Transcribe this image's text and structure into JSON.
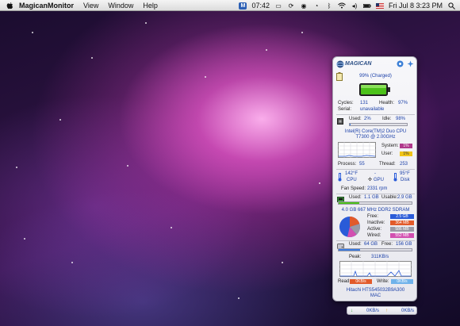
{
  "menubar": {
    "app_name": "MagicanMonitor",
    "menus": [
      "View",
      "Window",
      "Help"
    ],
    "time": "07:42",
    "datetime": "Fri Jul 8  3:23 PM"
  },
  "widget": {
    "brand": "MAGICAN",
    "battery": {
      "percent_label": "99% (Charged)",
      "level": 0.99,
      "cycles_label": "Cycles:",
      "cycles_value": "131",
      "health_label": "Health:",
      "health_value": "97%",
      "serial_label": "Serial:",
      "serial_value": "unavailable"
    },
    "cpu": {
      "used_label": "Used:",
      "used_value": "2%",
      "idle_label": "Idle:",
      "idle_value": "98%",
      "model_line1": "Intel(R) Core(TM)2 Duo CPU",
      "model_line2": "T7300  @ 2.00GHz",
      "system_label": "System:",
      "system_value": "1%",
      "user_label": "User:",
      "user_value": "1%",
      "process_label": "Process:",
      "process_value": "55",
      "thread_label": "Thread:",
      "thread_value": "253"
    },
    "temps": {
      "cpu_temp": "142°F",
      "cpu_label": "CPU",
      "gpu_temp": "-",
      "gpu_label": "GPU",
      "disk_temp": "95°F",
      "disk_label": "Disk",
      "fan_label": "Fan Speed:",
      "fan_value": "2331 rpm"
    },
    "memory": {
      "used_label": "Used:",
      "used_value": "1.1 GB",
      "usable_label": "Usable:",
      "usable_value": "2.9 GB",
      "usage_level": 0.28,
      "description": "4.0 GB 667 MHz DDR2 SDRAM",
      "rows": [
        {
          "label": "Free:",
          "value": "2.5 GB",
          "color": "#2a5bd8"
        },
        {
          "label": "Inactive:",
          "value": "364 MB",
          "color": "#e25a2a"
        },
        {
          "label": "Active:",
          "value": "586 MB",
          "color": "#9a9aa6"
        },
        {
          "label": "Wired:",
          "value": "552 MB",
          "color": "#d24fb0"
        }
      ]
    },
    "disk": {
      "used_label": "Used:",
      "used_value": "64 GB",
      "free_label": "Free:",
      "free_value": "156 GB",
      "usage_level": 0.29,
      "peak_label": "Peak:",
      "peak_value": "311KB/s",
      "read_label": "Read:",
      "read_value": "0KB/s",
      "write_label": "Write:",
      "write_value": "0KB/s",
      "model": "Hitachi HTS545032B9A300",
      "model2": "MAC"
    },
    "network": {
      "down_value": "0KB/s",
      "up_value": "0KB/s"
    },
    "colors": {
      "accent_blue": "#1a3fa8",
      "system_chip": "#b0398c",
      "user_chip": "#f0c419",
      "battery_green": "#4cc21a"
    }
  }
}
